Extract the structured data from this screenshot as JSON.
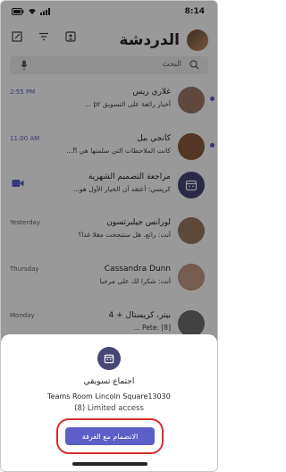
{
  "status_bar": {
    "time": "8:14"
  },
  "header": {
    "title": "الدردشة",
    "new_chat_icon": "compose-icon",
    "filter_icon": "filter-icon",
    "meet_icon": "meet-now-icon"
  },
  "search": {
    "placeholder": "البحث"
  },
  "chats": [
    {
      "name": "غلاري ريس",
      "preview": "أخبار رائعة على التسويق pr ...",
      "time": "2:55 PM",
      "unread": true,
      "avatar_color": "#a07868"
    },
    {
      "name": "كانجي بيل",
      "preview": "كانت الملاحظات التي سلمتها هي fi...",
      "time": "11:00 AM",
      "unread": true,
      "avatar_color": "#8a5a3c"
    },
    {
      "name": "مراجعة التصميم الشهرية",
      "preview": "كريسي: أعتقد أن الخيار الأول هو...",
      "time": "",
      "unread": false,
      "avatar_color": "#464775"
    },
    {
      "name": "لورانس جيلبرتسون",
      "preview": "أنت: رائع. هل ستنجحت مغلا غدا؟",
      "time": "Yesterday",
      "unread": false,
      "avatar_color": "#9c7a62"
    },
    {
      "name": "Cassandra Dunn",
      "preview": "أنت: شكرا لك على مرحبا",
      "time": "Thursday",
      "unread": false,
      "avatar_color": "#c29a86"
    },
    {
      "name": "بيتر، كريستال + 4",
      "preview": "Pete: [8] ...",
      "time": "Monday",
      "unread": false,
      "avatar_color": "#6e6e6e"
    }
  ],
  "sheet": {
    "title": "اجتماع تسويقي",
    "room": "Teams Room Lincoln Square13030",
    "access": "(8) Limited access",
    "join_label": "الانضمام مع الغرفة"
  },
  "colors": {
    "accent": "#5b5fc7",
    "highlight": "#d92c2c"
  }
}
